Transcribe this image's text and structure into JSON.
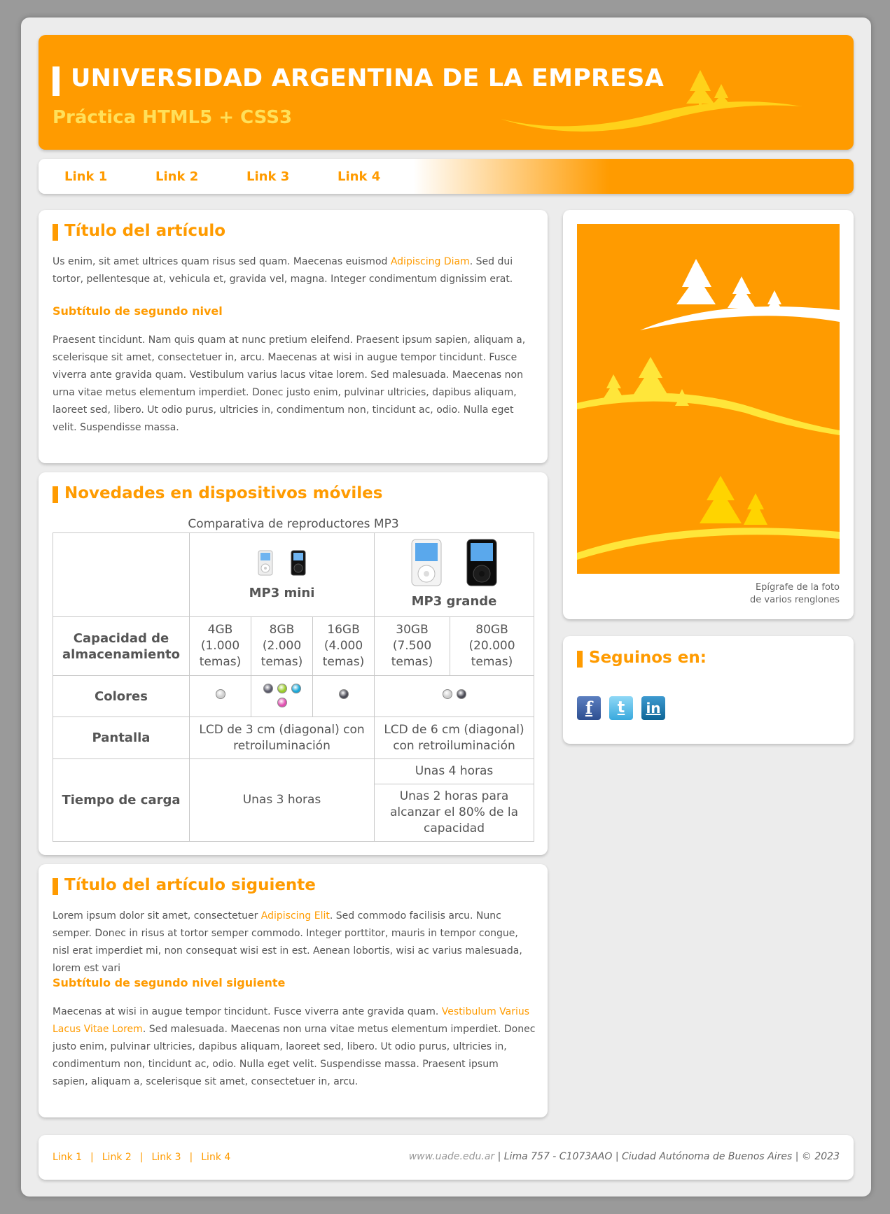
{
  "header": {
    "title": "UNIVERSIDAD ARGENTINA DE LA EMPRESA",
    "subtitle": "Práctica HTML5 + CSS3"
  },
  "nav": [
    "Link 1",
    "Link 2",
    "Link 3",
    "Link 4"
  ],
  "article1": {
    "title": "Título del artículo",
    "p1_a": "Us enim, sit amet ultrices quam risus sed quam. Maecenas euismod ",
    "p1_hl": "Adipiscing Diam",
    "p1_b": ". Sed dui tortor, pellentesque at, vehicula et, gravida vel, magna. Integer condimentum dignissim erat.",
    "subtitle": "Subtítulo de segundo nivel",
    "p2": "Praesent tincidunt. Nam quis quam at nunc pretium eleifend. Praesent ipsum sapien, aliquam a, scelerisque sit amet, consectetuer in, arcu. Maecenas at wisi in augue tempor tincidunt. Fusce viverra ante gravida quam. Vestibulum varius lacus vitae lorem. Sed malesuada. Maecenas non urna vitae metus elementum imperdiet. Donec justo enim, pulvinar ultricies, dapibus aliquam, laoreet sed, libero. Ut odio purus, ultricies in, condimentum non, tincidunt ac, odio. Nulla eget velit. Suspendisse massa."
  },
  "novedades": {
    "title": "Novedades en dispositivos móviles",
    "caption": "Comparativa de reproductores MP3",
    "mini": "MP3 mini",
    "grande": "MP3 grande",
    "row_capacidad": "Capacidad de almacenamiento",
    "cap": [
      {
        "gb": "4GB",
        "temas": "(1.000 temas)"
      },
      {
        "gb": "8GB",
        "temas": "(2.000 temas)"
      },
      {
        "gb": "16GB",
        "temas": "(4.000 temas)"
      },
      {
        "gb": "30GB",
        "temas": "(7.500 temas)"
      },
      {
        "gb": "80GB",
        "temas": "(20.000 temas)"
      }
    ],
    "row_colores": "Colores",
    "colors": {
      "c4gb": [
        "#cfcfcf"
      ],
      "c8gb": [
        "#5a5a6a",
        "#9bcc2a",
        "#1aa8d8",
        "#e04fb0"
      ],
      "c16gb": [
        "#4a4a55"
      ],
      "grande": [
        "#cfcfcf",
        "#4a4a55"
      ]
    },
    "row_pantalla": "Pantalla",
    "pantalla_mini": "LCD de 3 cm (diagonal) con retroiluminación",
    "pantalla_grande": "LCD de 6 cm (diagonal) con retroiluminación",
    "row_carga": "Tiempo de carga",
    "carga_mini": "Unas 3 horas",
    "carga_grande_1": "Unas 4 horas",
    "carga_grande_2": "Unas 2 horas para alcanzar el 80% de la capacidad"
  },
  "article2": {
    "title": "Título del artículo siguiente",
    "p1_a": "Lorem ipsum dolor sit amet, consectetuer ",
    "p1_hl": "Adipiscing Elit",
    "p1_b": ". Sed commodo facilisis arcu. Nunc semper. Donec in risus at tortor semper commodo. Integer porttitor, mauris in tempor congue, nisl erat imperdiet mi, non consequat wisi est in est. Aenean lobortis, wisi ac varius malesuada, lorem est vari",
    "subtitle": "Subtítulo de segundo nivel siguiente",
    "p2_a": "Maecenas at wisi in augue tempor tincidunt. Fusce viverra ante gravida quam. ",
    "p2_hl": "Vestibulum Varius Lacus Vitae Lorem",
    "p2_b": ". Sed malesuada. Maecenas non urna vitae metus elementum imperdiet. Donec justo enim, pulvinar ultricies, dapibus aliquam, laoreet sed, libero. Ut odio purus, ultricies in, condimentum non, tincidunt ac, odio. Nulla eget velit. Suspendisse massa. Praesent ipsum sapien, aliquam a, scelerisque sit amet, consectetuer in, arcu."
  },
  "photo": {
    "caption_1": "Epígrafe de la foto",
    "caption_2": "de varios renglones"
  },
  "social": {
    "title": "Seguinos en:",
    "icons": [
      "facebook-icon",
      "twitter-icon",
      "linkedin-icon"
    ],
    "fb": "f",
    "tw": "t",
    "in": "in"
  },
  "footer": {
    "links": [
      "Link 1",
      "Link 2",
      "Link 3",
      "Link 4"
    ],
    "site": "www.uade.edu.ar",
    "address": " | Lima 757 - C1073AAO | Ciudad Autónoma de Buenos Aires | © 2023"
  },
  "colors": {
    "accent": "#ff9b00",
    "accent_light": "#ffe05a",
    "background": "#ececec"
  }
}
